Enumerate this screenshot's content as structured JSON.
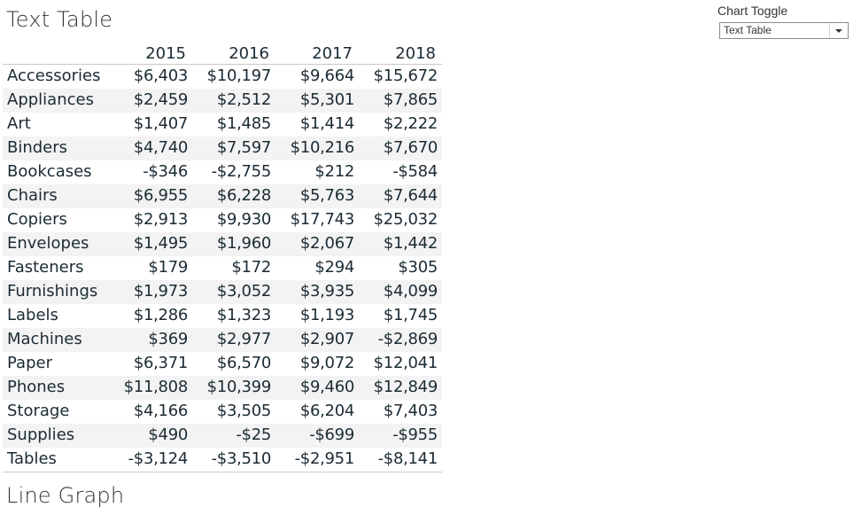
{
  "page": {
    "title": "Text Table",
    "next_section_title": "Line Graph"
  },
  "parameter_control": {
    "label": "Chart Toggle",
    "selected_value": "Text Table",
    "icon": "chevron-down-icon"
  },
  "table": {
    "columns": [
      "2015",
      "2016",
      "2017",
      "2018"
    ],
    "rows": [
      {
        "label": "Accessories",
        "values": [
          "$6,403",
          "$10,197",
          "$9,664",
          "$15,672"
        ]
      },
      {
        "label": "Appliances",
        "values": [
          "$2,459",
          "$2,512",
          "$5,301",
          "$7,865"
        ]
      },
      {
        "label": "Art",
        "values": [
          "$1,407",
          "$1,485",
          "$1,414",
          "$2,222"
        ]
      },
      {
        "label": "Binders",
        "values": [
          "$4,740",
          "$7,597",
          "$10,216",
          "$7,670"
        ]
      },
      {
        "label": "Bookcases",
        "values": [
          "-$346",
          "-$2,755",
          "$212",
          "-$584"
        ]
      },
      {
        "label": "Chairs",
        "values": [
          "$6,955",
          "$6,228",
          "$5,763",
          "$7,644"
        ]
      },
      {
        "label": "Copiers",
        "values": [
          "$2,913",
          "$9,930",
          "$17,743",
          "$25,032"
        ]
      },
      {
        "label": "Envelopes",
        "values": [
          "$1,495",
          "$1,960",
          "$2,067",
          "$1,442"
        ]
      },
      {
        "label": "Fasteners",
        "values": [
          "$179",
          "$172",
          "$294",
          "$305"
        ]
      },
      {
        "label": "Furnishings",
        "values": [
          "$1,973",
          "$3,052",
          "$3,935",
          "$4,099"
        ]
      },
      {
        "label": "Labels",
        "values": [
          "$1,286",
          "$1,323",
          "$1,193",
          "$1,745"
        ]
      },
      {
        "label": "Machines",
        "values": [
          "$369",
          "$2,977",
          "$2,907",
          "-$2,869"
        ]
      },
      {
        "label": "Paper",
        "values": [
          "$6,371",
          "$6,570",
          "$9,072",
          "$12,041"
        ]
      },
      {
        "label": "Phones",
        "values": [
          "$11,808",
          "$10,399",
          "$9,460",
          "$12,849"
        ]
      },
      {
        "label": "Storage",
        "values": [
          "$4,166",
          "$3,505",
          "$6,204",
          "$7,403"
        ]
      },
      {
        "label": "Supplies",
        "values": [
          "$490",
          "-$25",
          "-$699",
          "-$955"
        ]
      },
      {
        "label": "Tables",
        "values": [
          "-$3,124",
          "-$3,510",
          "-$2,951",
          "-$8,141"
        ]
      }
    ]
  },
  "colors": {
    "text": "#1b2b34",
    "band": "#f3f3f3",
    "divider": "#c8c8c8"
  }
}
